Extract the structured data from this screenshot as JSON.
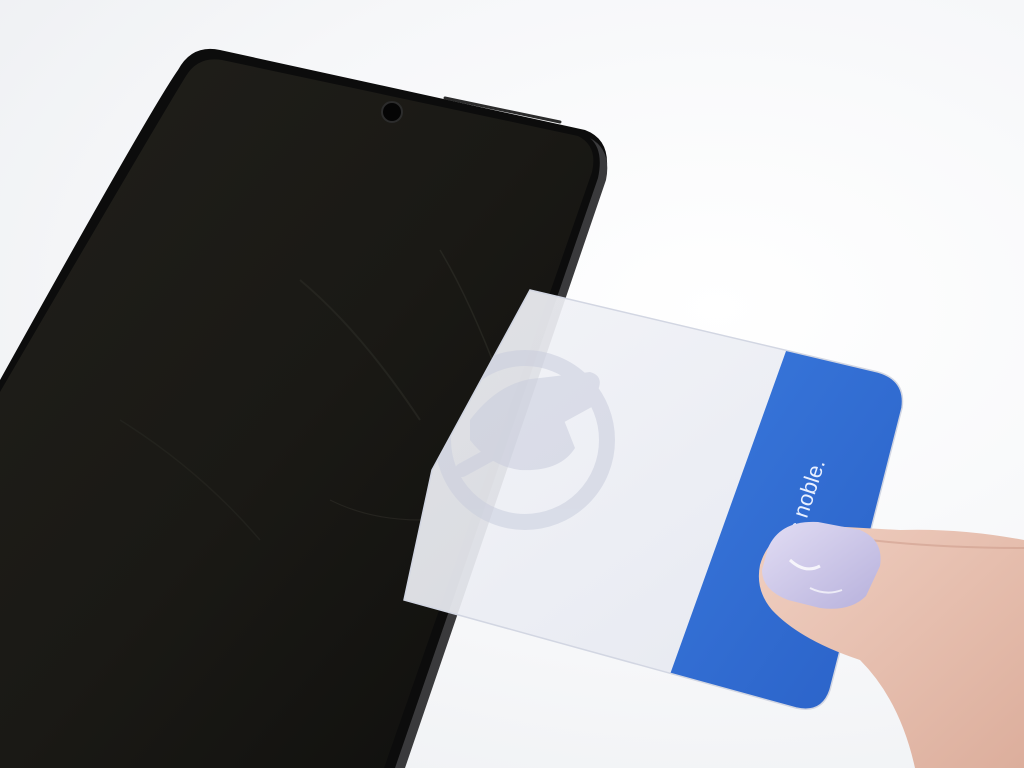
{
  "photo": {
    "card_slogan": "is noble.",
    "colors": {
      "background": "#f4f5f7",
      "phone_body": "#141414",
      "phone_screen": "#1a1915",
      "card_clear": "#eef0f6",
      "card_blue": "#2f6fd6",
      "nail_polish": "#c9c4e6",
      "skin": "#e8c2b2"
    }
  }
}
